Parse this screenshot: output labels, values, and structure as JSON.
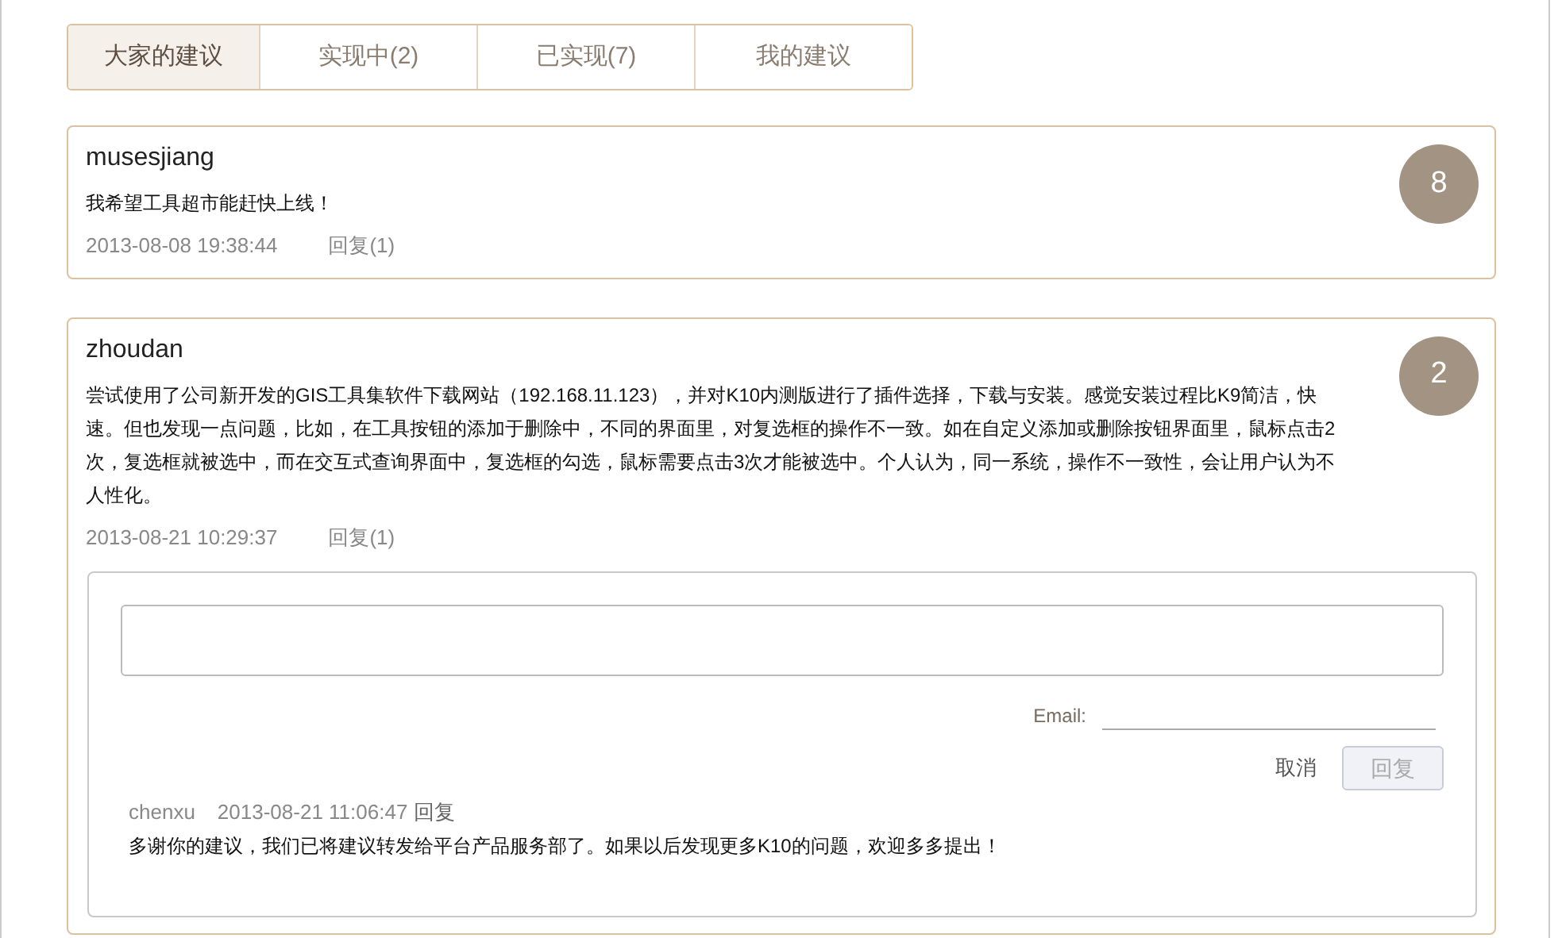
{
  "tabs": [
    {
      "label": "大家的建议",
      "selected": true
    },
    {
      "label": "实现中(2)",
      "selected": false
    },
    {
      "label": "已实现(7)",
      "selected": false
    },
    {
      "label": "我的建议",
      "selected": false
    }
  ],
  "posts": [
    {
      "author": "musesjiang",
      "text": "我希望工具超市能赶快上线！",
      "time": "2013-08-08 19:38:44",
      "reply_link": "回复(1)",
      "votes": "8"
    },
    {
      "author": "zhoudan",
      "text": "尝试使用了公司新开发的GIS工具集软件下载网站（192.168.11.123），并对K10内测版进行了插件选择，下载与安装。感觉安装过程比K9简洁，快速。但也发现一点问题，比如，在工具按钮的添加于删除中，不同的界面里，对复选框的操作不一致。如在自定义添加或删除按钮界面里，鼠标点击2次，复选框就被选中，而在交互式查询界面中，复选框的勾选，鼠标需要点击3次才能被选中。个人认为，同一系统，操作不一致性，会让用户认为不人性化。",
      "time": "2013-08-21 10:29:37",
      "reply_link": "回复(1)",
      "votes": "2",
      "reply_panel": {
        "email_label": "Email:",
        "cancel": "取消",
        "submit": {
          "label": "回复",
          "disabled": true
        },
        "replies": [
          {
            "author": "chenxu",
            "time": "2013-08-21 11:06:47",
            "action": "回复",
            "text": "多谢你的建议，我们已将建议转发给平台产品服务部了。如果以后发现更多K10的问题，欢迎多多提出！"
          }
        ]
      }
    }
  ]
}
